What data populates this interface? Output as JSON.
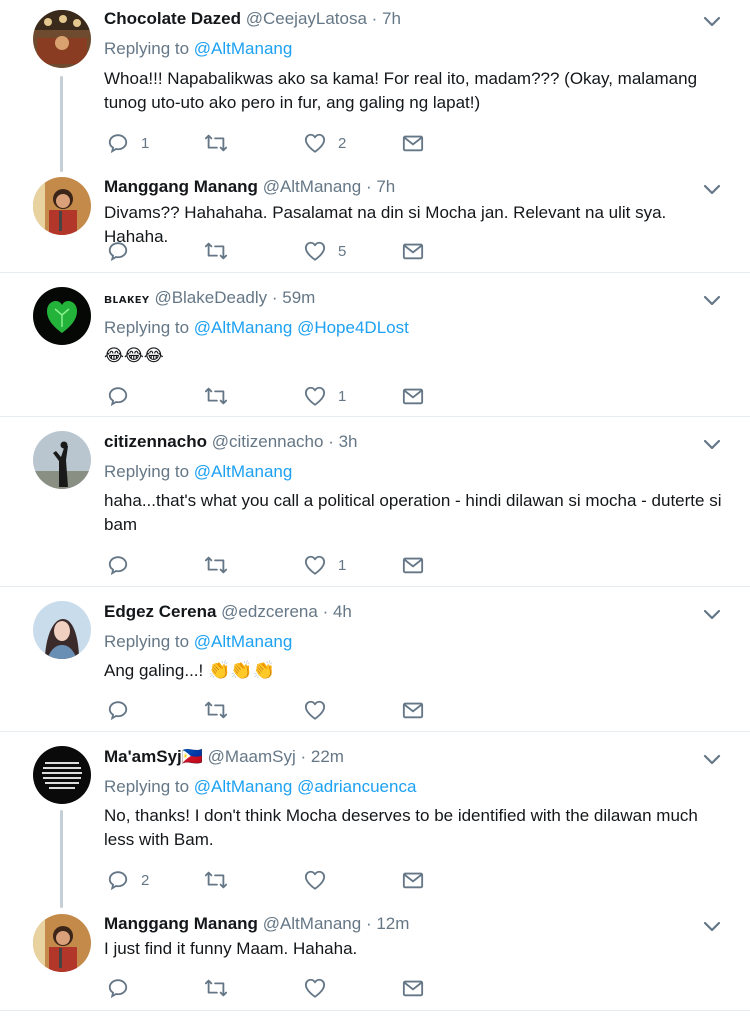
{
  "colors": {
    "link": "#1da1f2",
    "muted": "#657786",
    "text": "#14171a",
    "divider": "#e6ecf0",
    "thread": "#c4cfd6"
  },
  "replying_label": "Replying to",
  "tweets": [
    {
      "name": "Chocolate Dazed",
      "handle": "@CeejayLatosa",
      "time": "· 7h",
      "replying": [
        "@AltManang"
      ],
      "text": "Whoa!!! Napabalikwas ako sa kama! For real ito, madam??? (Okay, malamang tunog uto-uto ako pero in fur, ang galing ng lapat!)",
      "replies": "1",
      "retweets": "",
      "likes": "2"
    },
    {
      "name": "Manggang Manang",
      "handle": "@AltManang",
      "time": "· 7h",
      "text": "Divams?? Hahahaha. Pasalamat na din si Mocha jan. Relevant na ulit sya. Hahaha.",
      "replies": "",
      "retweets": "",
      "likes": "5"
    },
    {
      "name": "ʙʟᴀᴋᴇʏ",
      "handle": "@BlakeDeadly",
      "time": "· 59m",
      "replying": [
        "@AltManang",
        "@Hope4DLost"
      ],
      "text": "😂😂😂",
      "replies": "",
      "retweets": "",
      "likes": "1"
    },
    {
      "name": "citizennacho",
      "handle": "@citizennacho",
      "time": "· 3h",
      "replying": [
        "@AltManang"
      ],
      "text": "haha...that's what you call a political operation - hindi dilawan si mocha - duterte si bam",
      "replies": "",
      "retweets": "",
      "likes": "1"
    },
    {
      "name": "Edgez Cerena",
      "handle": "@edzcerena",
      "time": "· 4h",
      "replying": [
        "@AltManang"
      ],
      "text": "Ang galing...!",
      "emoji": "👏👏👏",
      "replies": "",
      "retweets": "",
      "likes": ""
    },
    {
      "name": "Ma'amSyj",
      "flag": "🇵🇭",
      "handle": "@MaamSyj",
      "time": "· 22m",
      "replying": [
        "@AltManang",
        "@adriancuenca"
      ],
      "text": "No, thanks! I don't think Mocha deserves to be identified with the dilawan much less with Bam.",
      "replies": "2",
      "retweets": "",
      "likes": ""
    },
    {
      "name": "Manggang Manang",
      "handle": "@AltManang",
      "time": "· 12m",
      "text": "I just find it funny Maam. Hahaha.",
      "replies": "",
      "retweets": "",
      "likes": ""
    }
  ]
}
